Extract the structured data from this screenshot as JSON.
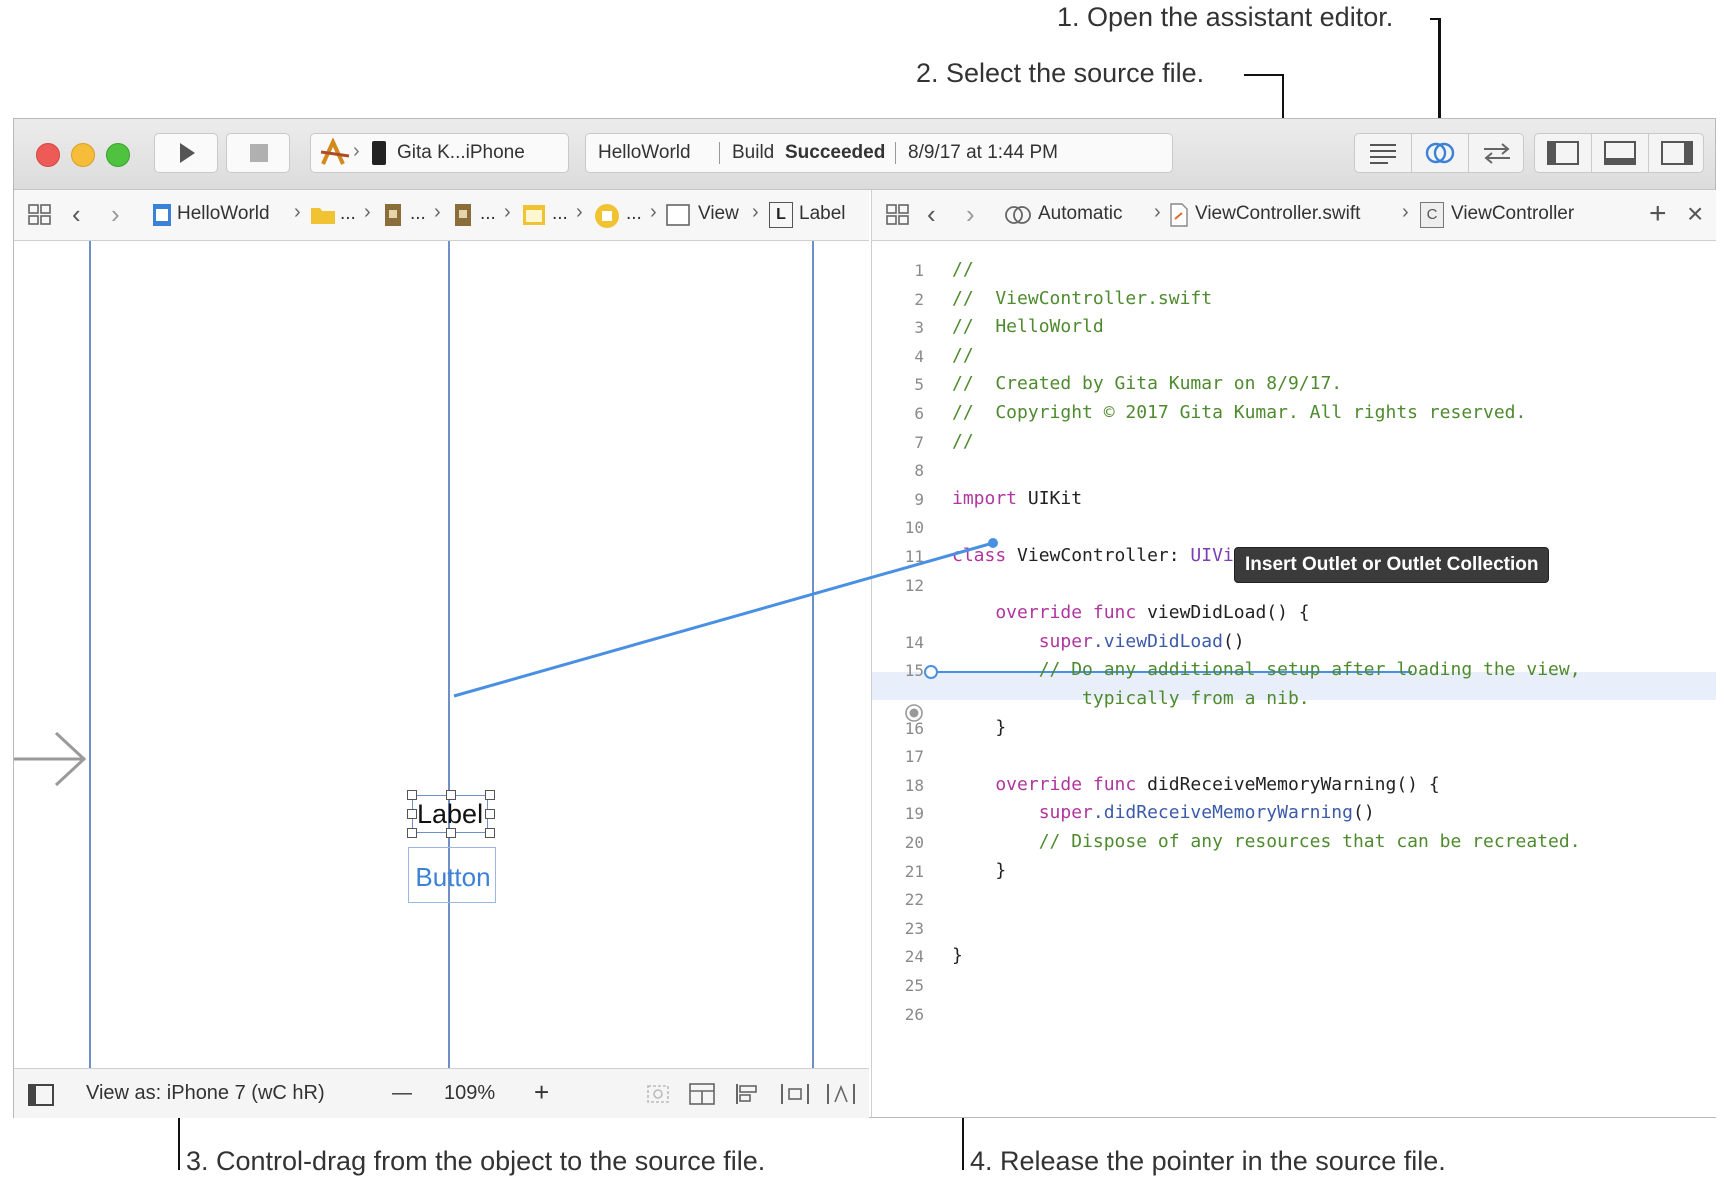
{
  "callouts": {
    "step1": "1. Open the assistant editor.",
    "step2": "2. Select the source file.",
    "step3": "3. Control-drag from the object to the source file.",
    "step4": "4. Release the pointer in the source file."
  },
  "toolbar": {
    "scheme_device": "Gita K...iPhone",
    "status_project": "HelloWorld",
    "status_prefix": "Build",
    "status_result": "Succeeded",
    "status_time": "8/9/17 at 1:44 PM"
  },
  "left_jumpbar": {
    "project": "HelloWorld",
    "ellipsis": "...",
    "view": "View",
    "label_badge": "L",
    "label": "Label"
  },
  "right_jumpbar": {
    "automatic": "Automatic",
    "file": "ViewController.swift",
    "class_badge": "C",
    "class_name": "ViewController",
    "add": "+",
    "close": "×"
  },
  "canvas": {
    "label_text": "Label",
    "button_text": "Button"
  },
  "bottom_bar": {
    "view_as": "View as: iPhone 7 (wC hR)",
    "zoom_out": "—",
    "zoom": "109%",
    "zoom_in": "+"
  },
  "tooltip": "Insert Outlet or Outlet Collection",
  "code_lines": [
    {
      "n": "1",
      "t": "//"
    },
    {
      "n": "2",
      "t": "//  ViewController.swift"
    },
    {
      "n": "3",
      "t": "//  HelloWorld"
    },
    {
      "n": "4",
      "t": "//"
    },
    {
      "n": "5",
      "t": "//  Created by Gita Kumar on 8/9/17."
    },
    {
      "n": "6",
      "t": "//  Copyright © 2017 Gita Kumar. All rights reserved."
    },
    {
      "n": "7",
      "t": "//"
    },
    {
      "n": "8",
      "t": ""
    },
    {
      "n": "9",
      "kw": "import",
      "rest": " UIKit"
    },
    {
      "n": "10",
      "t": ""
    },
    {
      "n": "11",
      "kw": "class",
      "mid": " ViewController: ",
      "type": "UIViewController",
      "end": " {"
    },
    {
      "n": "12",
      "t": ""
    },
    {
      "n": "",
      "kw": "    override func",
      "rest": " viewDidLoad() {"
    },
    {
      "n": "14",
      "fn_a": "        super",
      "fn_b": ".viewDidLoad",
      "end": "()"
    },
    {
      "n": "15",
      "c": "        // Do any additional setup after loading the view,"
    },
    {
      "n": "",
      "c": "            typically from a nib."
    },
    {
      "n": "16",
      "t": "    }"
    },
    {
      "n": "17",
      "t": ""
    },
    {
      "n": "18",
      "kw": "    override func",
      "rest": " didReceiveMemoryWarning() {"
    },
    {
      "n": "19",
      "fn_a": "        super",
      "fn_b": ".didReceiveMemoryWarning",
      "end": "()"
    },
    {
      "n": "20",
      "c": "        // Dispose of any resources that can be recreated."
    },
    {
      "n": "21",
      "t": "    }"
    },
    {
      "n": "22",
      "t": ""
    },
    {
      "n": "23",
      "t": ""
    },
    {
      "n": "24",
      "t": "}"
    },
    {
      "n": "25",
      "t": ""
    },
    {
      "n": "26",
      "t": ""
    }
  ],
  "colors": {
    "comment": "#4e8a2e",
    "keyword": "#b0359f",
    "type": "#7b3fb5",
    "connection": "#4a90e2"
  }
}
